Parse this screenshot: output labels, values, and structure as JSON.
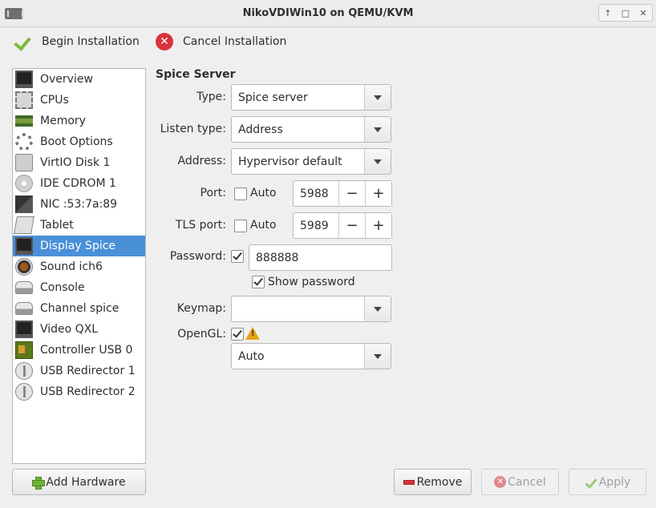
{
  "window": {
    "title": "NikoVDIWin10 on QEMU/KVM",
    "controls": [
      "↑",
      "□",
      "✕"
    ]
  },
  "toolbar": {
    "begin_label": "Begin Installation",
    "cancel_label": "Cancel Installation"
  },
  "hardware_list": {
    "items": [
      {
        "label": "Overview",
        "icon": "monitor-icon"
      },
      {
        "label": "CPUs",
        "icon": "cpu-icon"
      },
      {
        "label": "Memory",
        "icon": "memory-icon"
      },
      {
        "label": "Boot Options",
        "icon": "gears-icon"
      },
      {
        "label": "VirtIO Disk 1",
        "icon": "disk-icon"
      },
      {
        "label": "IDE CDROM 1",
        "icon": "cdrom-icon"
      },
      {
        "label": "NIC :53:7a:89",
        "icon": "network-icon"
      },
      {
        "label": "Tablet",
        "icon": "tablet-icon"
      },
      {
        "label": "Display Spice",
        "icon": "monitor-icon",
        "selected": true
      },
      {
        "label": "Sound ich6",
        "icon": "speaker-icon"
      },
      {
        "label": "Console",
        "icon": "console-icon"
      },
      {
        "label": "Channel spice",
        "icon": "console-icon"
      },
      {
        "label": "Video QXL",
        "icon": "monitor-icon"
      },
      {
        "label": "Controller USB 0",
        "icon": "usb-controller-icon"
      },
      {
        "label": "USB Redirector 1",
        "icon": "usb-icon"
      },
      {
        "label": "USB Redirector 2",
        "icon": "usb-icon"
      }
    ],
    "add_button_label": "Add Hardware"
  },
  "spice": {
    "section_title": "Spice Server",
    "type_label": "Type:",
    "type_value": "Spice server",
    "listen_label": "Listen type:",
    "listen_value": "Address",
    "address_label": "Address:",
    "address_value": "Hypervisor default",
    "port_label": "Port:",
    "port_auto_label": "Auto",
    "port_auto_checked": false,
    "port_value": "5988",
    "tls_label": "TLS port:",
    "tls_auto_label": "Auto",
    "tls_auto_checked": false,
    "tls_value": "5989",
    "password_label": "Password:",
    "password_checked": true,
    "password_value": "888888",
    "show_password_label": "Show password",
    "show_password_checked": true,
    "keymap_label": "Keymap:",
    "keymap_value": "",
    "opengl_label": "OpenGL:",
    "opengl_checked": true,
    "opengl_value": "Auto",
    "minus": "−",
    "plus": "+"
  },
  "buttons": {
    "remove_label": "Remove",
    "cancel_label": "Cancel",
    "apply_label": "Apply"
  }
}
